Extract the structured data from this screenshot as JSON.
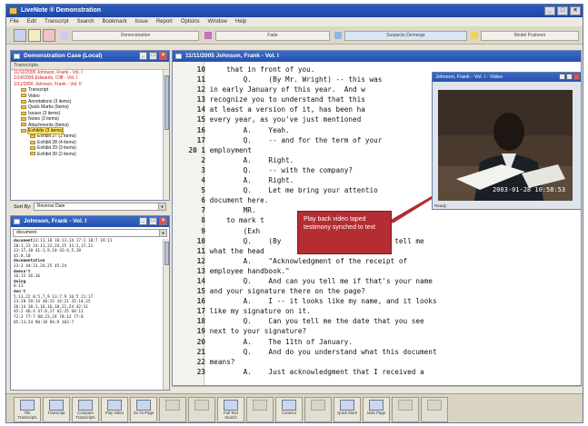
{
  "window": {
    "title": "LiveNote ® Demonstration"
  },
  "menu": [
    "File",
    "Edit",
    "Transcript",
    "Search",
    "Bookmark",
    "Issue",
    "Report",
    "Options",
    "Window",
    "Help"
  ],
  "toolbar": {
    "fields": [
      "Demonstration",
      "Fade",
      "Suspects Demerge",
      "Model Pusheen"
    ]
  },
  "case_panel": {
    "title": "Demonstration Case (Local)",
    "tab": "Transcripts",
    "items": [
      {
        "text": "11/11/2005 Johnson, Frank - Vol. I",
        "style": "red"
      },
      {
        "text": "1/14/2006 Edwards, Cliff - Vol. I",
        "style": "red"
      },
      {
        "text": "1/11/2006 Johnson, Frank - Vol. II",
        "style": "red"
      },
      {
        "text": "Transcript",
        "style": "folder"
      },
      {
        "text": "Video",
        "style": "folder"
      },
      {
        "text": "Annotations (3 items)",
        "style": "folder"
      },
      {
        "text": "Quick Marks (Items)",
        "style": "folder"
      },
      {
        "text": "Issues (3 items)",
        "style": "folder"
      },
      {
        "text": "Notes (3 items)",
        "style": "folder"
      },
      {
        "text": "Attachments (Items)",
        "style": "folder"
      },
      {
        "text": "Exhibits (3 items)",
        "style": "folder-hl"
      },
      {
        "text": "Exhibit 27 (2 items)",
        "style": "folder-sub"
      },
      {
        "text": "Exhibit 28 (4 items)",
        "style": "folder-sub"
      },
      {
        "text": "Exhibit 29 (3 items)",
        "style": "folder-sub"
      },
      {
        "text": "Exhibit 30 (2 items)",
        "style": "folder-sub"
      }
    ],
    "sort_label": "Sort By:",
    "sort_value": "Reverse Date"
  },
  "word_panel": {
    "title": "Johnson, Frank - Vol. I",
    "select_value": "document",
    "entries": [
      {
        "word": "document",
        "refs": "13:11,18 16:13,14 17:1 18:7 19:11"
      },
      {
        "word": "",
        "refs": "20:1,23 24:11,22,24,25 31:1,17,21"
      },
      {
        "word": "",
        "refs": "33:17,18 41:1,9,10 42:4,5,10"
      },
      {
        "word": "",
        "refs": "45:8,10"
      },
      {
        "word": "documentation",
        "refs": ""
      },
      {
        "word": "",
        "refs": "23:3 44:23,24,25 45:24"
      },
      {
        "word": "doesn't",
        "refs": ""
      },
      {
        "word": "",
        "refs": "16:15 36:16"
      },
      {
        "word": "doing",
        "refs": ""
      },
      {
        "word": "",
        "refs": "8:13"
      },
      {
        "word": "don't",
        "refs": ""
      },
      {
        "word": "",
        "refs": "5:13,22 8:5,7,9 13:7,9 16:5 21:17"
      },
      {
        "word": "",
        "refs": "23:20 29:14 30:15 34:21 35:14,25"
      },
      {
        "word": "",
        "refs": "36:14 38:1,16,16,18,21,24 42:11"
      },
      {
        "word": "",
        "refs": "45:2 46:4 47:6,17 62:25 68:11"
      },
      {
        "word": "",
        "refs": "72:3 77:7 80:23,24 78:12 77:8"
      },
      {
        "word": "",
        "refs": "85:13,24 90:18 94:9 103:7"
      }
    ]
  },
  "transcript": {
    "title": "11/11/2005 Johnson, Frank - Vol. I",
    "lines": [
      {
        "n": "10",
        "text": "    that in front of you."
      },
      {
        "n": "11",
        "text": "        Q.    (By Mr. Wright) -- this was"
      },
      {
        "n": "12",
        "text": "in early January of this year.  And w"
      },
      {
        "n": "13",
        "text": "recognize you to understand that this"
      },
      {
        "n": "14",
        "text": "at least a version of it, has been ha"
      },
      {
        "n": "15",
        "text": "every year, as you've just mentioned"
      },
      {
        "n": "16",
        "text": "        A.    Yeah."
      },
      {
        "n": "17",
        "text": "        Q.    -- and for the term of your"
      },
      {
        "n": "20 1",
        "text": "employment"
      },
      {
        "n": "2",
        "text": "        A.    Right."
      },
      {
        "n": "3",
        "text": "        Q.    -- with the company?"
      },
      {
        "n": "4",
        "text": "        A.    Right."
      },
      {
        "n": "5",
        "text": "        Q.    Let me bring your attentio"
      },
      {
        "n": "6",
        "text": "document here."
      },
      {
        "n": "7",
        "text": "        MR."
      },
      {
        "n": "8",
        "text": "    to mark t"
      },
      {
        "n": "9",
        "text": "        (Exh"
      },
      {
        "n": "10",
        "text": "        Q.    (By                   can you tell me"
      },
      {
        "n": "11",
        "text": "what the head                   e?"
      },
      {
        "n": "12",
        "text": "        A.    \"Acknowledgment of the receipt of"
      },
      {
        "n": "13",
        "text": "employee handbook.\""
      },
      {
        "n": "14",
        "text": "        Q.    And can you tell me if that's your name"
      },
      {
        "n": "15",
        "text": "and your signature there on the page?"
      },
      {
        "n": "16",
        "text": "        A.    I -- it looks like my name, and it looks"
      },
      {
        "n": "17",
        "text": "like my signature on it."
      },
      {
        "n": "18",
        "text": "        Q.    Can you tell me the date that you see"
      },
      {
        "n": "19",
        "text": "next to your signature?"
      },
      {
        "n": "20",
        "text": "        A.    The 11th of January."
      },
      {
        "n": "21",
        "text": "        Q.    And do you understand what this document"
      },
      {
        "n": "22",
        "text": "means?"
      },
      {
        "n": "23",
        "text": "        A.    Just acknowledgment that I received a"
      }
    ],
    "video_window": {
      "title": "Johnson, Frank - Vol. I - Video",
      "timestamp": "2003-01-28 10:58:53",
      "status": "Ready"
    },
    "callout": "Play back video taped testimony synched to text"
  },
  "bottom_toolbar": [
    {
      "label": "Tile Transcripts",
      "enabled": true
    },
    {
      "label": "Transcript",
      "enabled": true
    },
    {
      "label": "Compare Transcripts",
      "enabled": true
    },
    {
      "label": "Play Video",
      "enabled": true
    },
    {
      "label": "Go To Page",
      "enabled": true
    },
    {
      "label": "",
      "enabled": false
    },
    {
      "label": "",
      "enabled": false
    },
    {
      "label": "Full Text Search",
      "enabled": true
    },
    {
      "label": "",
      "enabled": false
    },
    {
      "label": "Connect",
      "enabled": true
    },
    {
      "label": "",
      "enabled": false
    },
    {
      "label": "Quick Mark",
      "enabled": true
    },
    {
      "label": "Note Page",
      "enabled": true
    },
    {
      "label": "",
      "enabled": false
    },
    {
      "label": "",
      "enabled": false
    }
  ]
}
